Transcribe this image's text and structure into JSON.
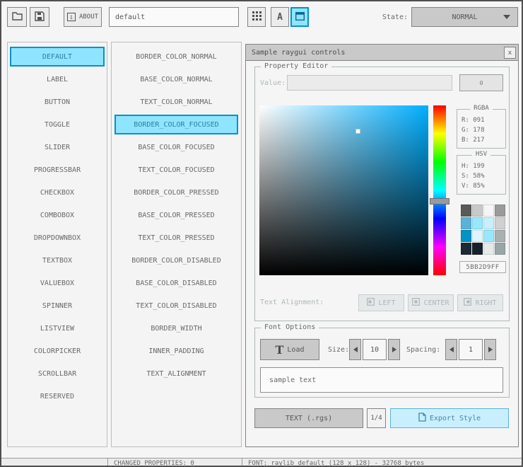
{
  "colors": {
    "accent_border": "#0492c7",
    "accent_fill": "#97e8ff",
    "accent_text": "#368baf",
    "focus_border": "#5bb2d9",
    "focus_fill": "#c9effe",
    "picked_color": "#5BB2D9"
  },
  "icons": {
    "close": "x",
    "about_info": "i",
    "font_letter": "A"
  },
  "toolbar": {
    "style_name": "default",
    "about": "ABOUT",
    "state_label": "State:",
    "state_value": "NORMAL"
  },
  "controls": [
    "DEFAULT",
    "LABEL",
    "BUTTON",
    "TOGGLE",
    "SLIDER",
    "PROGRESSBAR",
    "CHECKBOX",
    "COMBOBOX",
    "DROPDOWNBOX",
    "TEXTBOX",
    "VALUEBOX",
    "SPINNER",
    "LISTVIEW",
    "COLORPICKER",
    "SCROLLBAR",
    "RESERVED"
  ],
  "properties": [
    "BORDER_COLOR_NORMAL",
    "BASE_COLOR_NORMAL",
    "TEXT_COLOR_NORMAL",
    "BORDER_COLOR_FOCUSED",
    "BASE_COLOR_FOCUSED",
    "TEXT_COLOR_FOCUSED",
    "BORDER_COLOR_PRESSED",
    "BASE_COLOR_PRESSED",
    "TEXT_COLOR_PRESSED",
    "BORDER_COLOR_DISABLED",
    "BASE_COLOR_DISABLED",
    "TEXT_COLOR_DISABLED",
    "BORDER_WIDTH",
    "INNER_PADDING",
    "TEXT_ALIGNMENT"
  ],
  "window": {
    "title": "Sample raygui controls",
    "property_editor": {
      "label": "Property Editor",
      "value_label": "Value:",
      "value_button": "0",
      "rgba_label": "RGBA",
      "rgba_r": "R: 091",
      "rgba_g": "G: 178",
      "rgba_b": "B: 217",
      "hsv_label": "HSV",
      "hsv_h": "H: 199",
      "hsv_s": "S: 58%",
      "hsv_v": "V: 85%",
      "hex_value": "5BB2D9FF",
      "palette": [
        "#5a5a5a",
        "#c9c9c9",
        "#f5f5f5",
        "#9a9a9a",
        "#5bb2d9",
        "#97e8ff",
        "#c9effe",
        "#d0d0d0",
        "#0492c7",
        "#e0f4fd",
        "#97e8ff",
        "#a8b0b0",
        "#1c2a35",
        "#16212b",
        "#e6e9e9",
        "#9aa5a8"
      ],
      "align_label": "Text Alignment:",
      "align_left": "LEFT",
      "align_center": "CENTER",
      "align_right": "RIGHT"
    },
    "font_options": {
      "label": "Font Options",
      "load_glyph": "T",
      "load_label": "Load",
      "size_label": "Size:",
      "size_value": "10",
      "spacing_label": "Spacing:",
      "spacing_value": "1",
      "sample_text": "sample text"
    },
    "footer": {
      "text_rgs": "TEXT (.rgs)",
      "page": "1/4",
      "export": "Export Style"
    }
  },
  "status": {
    "changed": "CHANGED PROPERTIES: 0",
    "font_info": "FONT: raylib default (128 x 128) - 32768 bytes"
  }
}
